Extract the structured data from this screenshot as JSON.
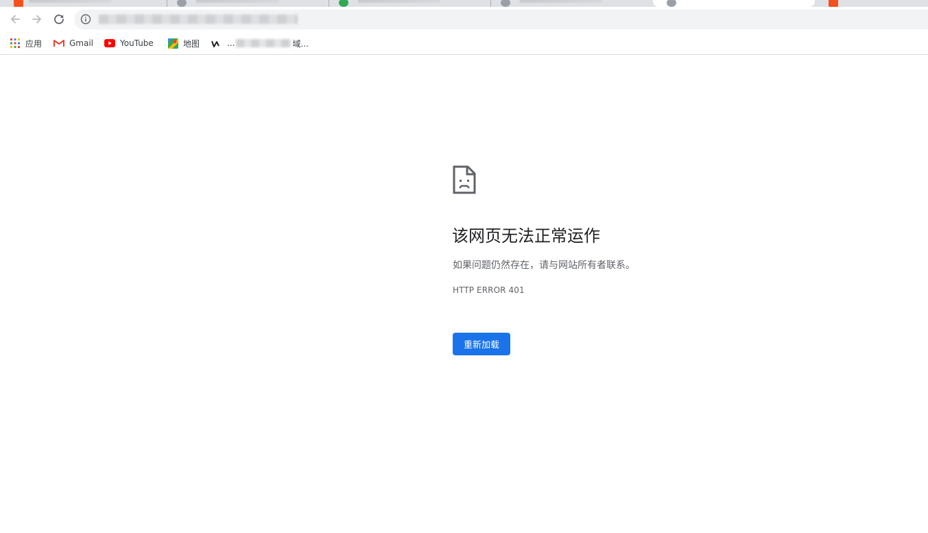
{
  "browser": {
    "address_bar": {
      "url": ""
    },
    "bookmarks": [
      {
        "label": "应用",
        "icon": "apps-grid-icon"
      },
      {
        "label": "Gmail",
        "icon": "gmail-icon"
      },
      {
        "label": "YouTube",
        "icon": "youtube-icon"
      },
      {
        "label": "地图",
        "icon": "maps-icon"
      },
      {
        "label": "...",
        "icon": "site-icon"
      },
      {
        "label": "域..."
      }
    ]
  },
  "error_page": {
    "heading": "该网页无法正常运作",
    "message": "如果问题仍然存在，请与网站所有者联系。",
    "error_code": "HTTP ERROR 401",
    "reload_label": "重新加载"
  },
  "colors": {
    "accent": "#1a73e8",
    "heading_text": "#202124",
    "secondary_text": "#5f6368"
  }
}
